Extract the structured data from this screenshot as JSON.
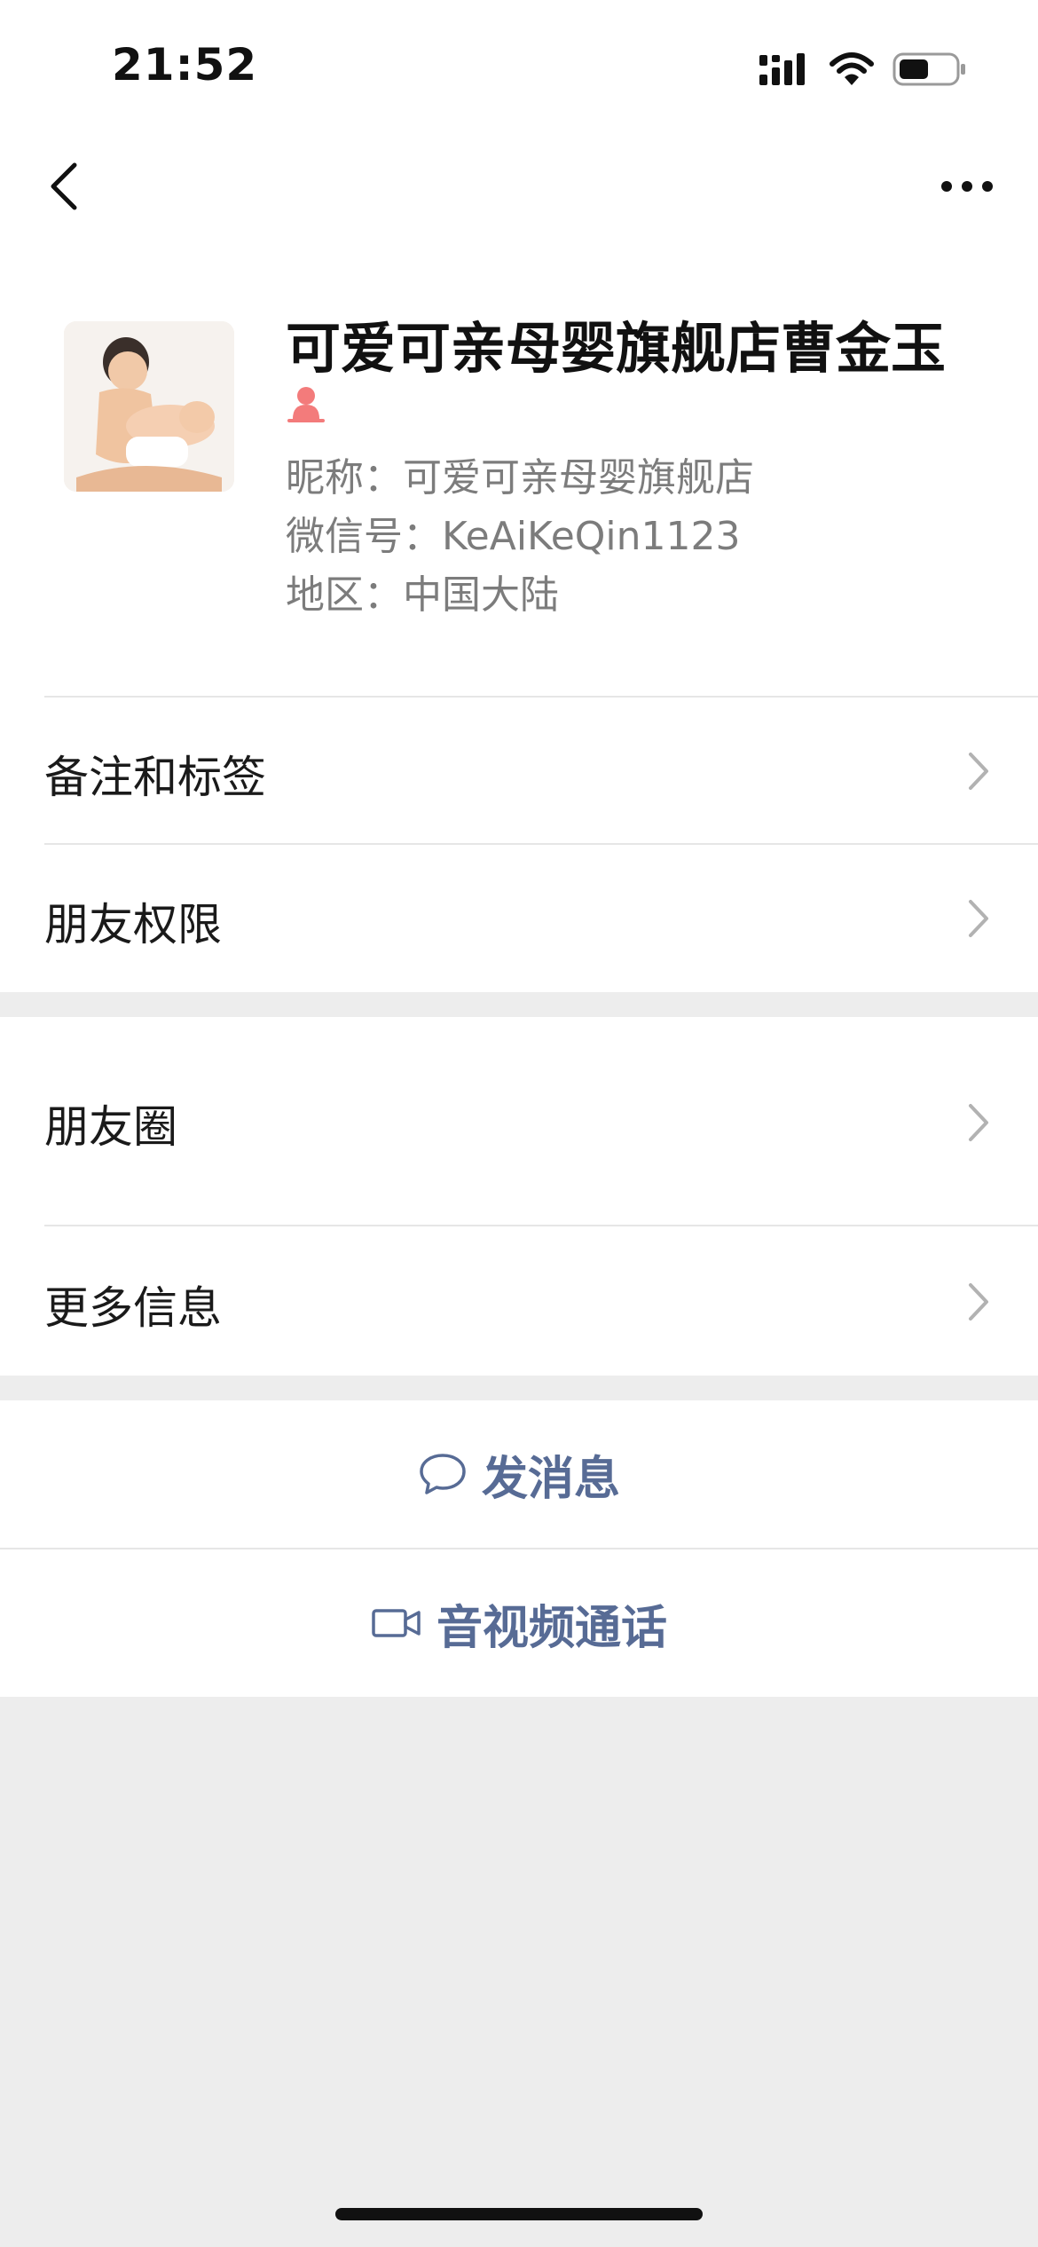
{
  "status_bar": {
    "time": "21:52"
  },
  "nav": {
    "back_icon": "chevron-left-icon",
    "more_icon": "more-dots-icon"
  },
  "profile": {
    "name": "可爱可亲母婴旗舰店曹金玉",
    "gender_icon": "female-icon",
    "gender_color": "#f37b7b",
    "nickname": "昵称：可爱可亲母婴旗舰店",
    "wechat_id": "微信号：KeAiKeQin1123",
    "region": "地区：中国大陆"
  },
  "rows": {
    "remarks": "备注和标签",
    "permissions": "朋友权限",
    "moments": "朋友圈",
    "more_info": "更多信息"
  },
  "actions": {
    "message": "发消息",
    "call": "音视频通话",
    "accent_color": "#576b95"
  }
}
